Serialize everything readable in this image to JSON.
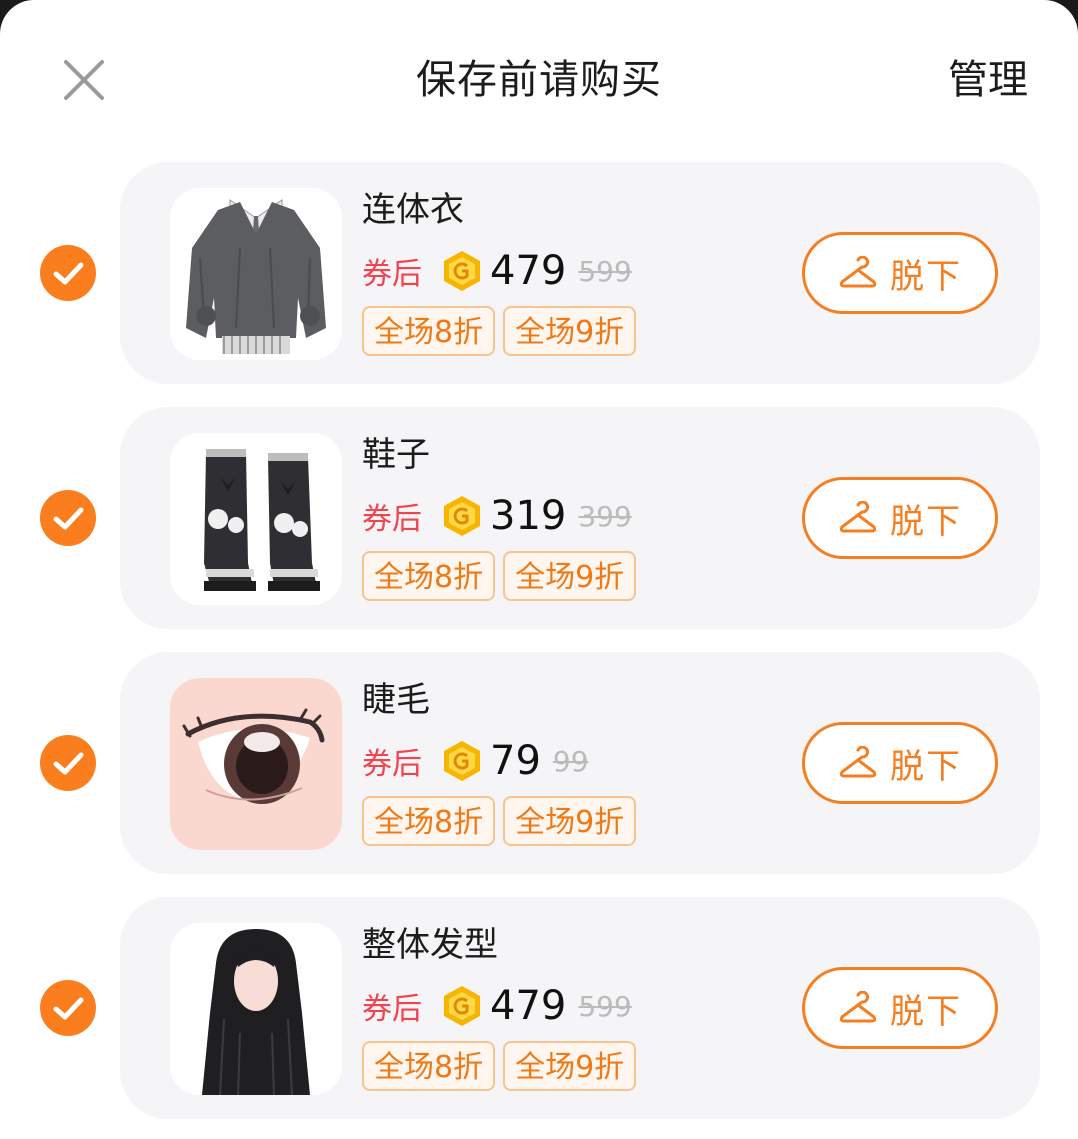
{
  "header": {
    "title": "保存前请购买",
    "manage_label": "管理"
  },
  "colors": {
    "accent": "#fa7d1e",
    "coupon_red": "#f2444f",
    "card_bg": "#f5f5f7"
  },
  "items": [
    {
      "name": "连体衣",
      "coupon_label": "券后",
      "price": "479",
      "original_price": "599",
      "tags": [
        "全场8折",
        "全场9折"
      ],
      "action_label": "脱下",
      "checked": true,
      "thumb_icon": "sweater-outfit-image"
    },
    {
      "name": "鞋子",
      "coupon_label": "券后",
      "price": "319",
      "original_price": "399",
      "tags": [
        "全场8折",
        "全场9折"
      ],
      "action_label": "脱下",
      "checked": true,
      "thumb_icon": "boots-image"
    },
    {
      "name": "睫毛",
      "coupon_label": "券后",
      "price": "79",
      "original_price": "99",
      "tags": [
        "全场8折",
        "全场9折"
      ],
      "action_label": "脱下",
      "checked": true,
      "thumb_icon": "eye-lashes-image"
    },
    {
      "name": "整体发型",
      "coupon_label": "券后",
      "price": "479",
      "original_price": "599",
      "tags": [
        "全场8折",
        "全场9折"
      ],
      "action_label": "脱下",
      "checked": true,
      "thumb_icon": "hairstyle-image"
    }
  ]
}
